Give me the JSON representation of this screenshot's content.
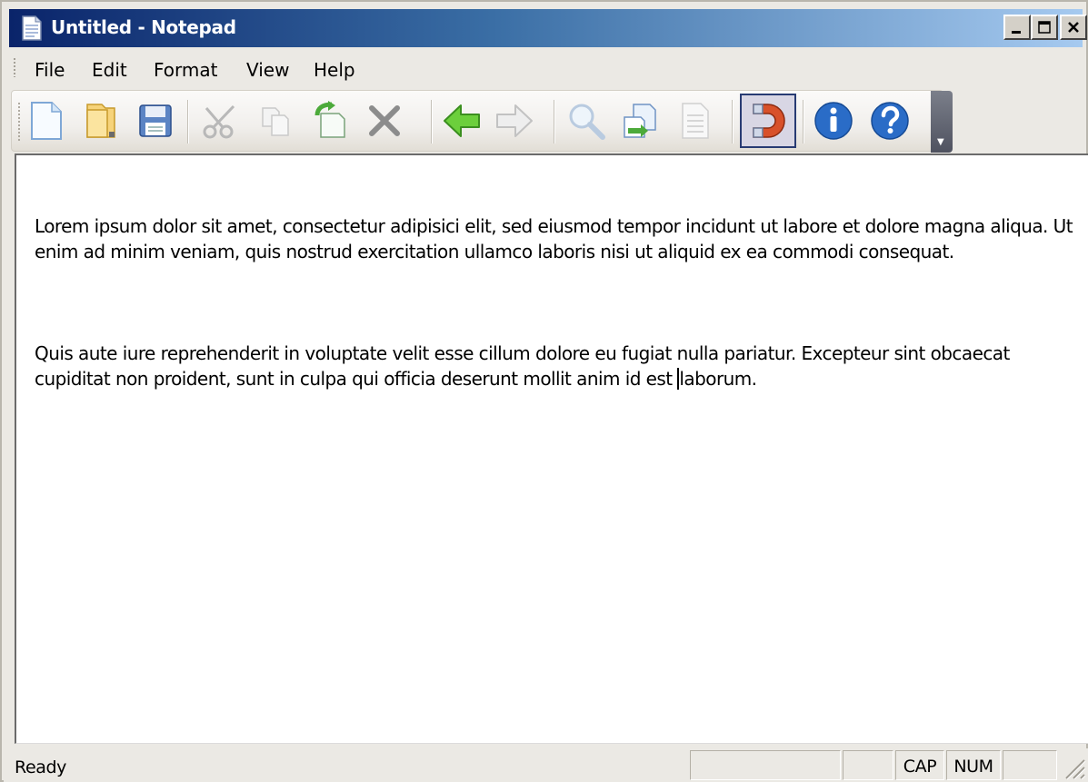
{
  "window": {
    "title": "Untitled - Notepad",
    "caption_buttons": [
      "minimize",
      "maximize",
      "close"
    ]
  },
  "menu": {
    "items": [
      {
        "label": "File"
      },
      {
        "label": "Edit"
      },
      {
        "label": "Format"
      },
      {
        "label": "View"
      },
      {
        "label": "Help"
      }
    ]
  },
  "toolbar": {
    "buttons": [
      {
        "icon": "new-document-icon"
      },
      {
        "icon": "open-folder-icon"
      },
      {
        "icon": "save-icon"
      },
      {
        "icon": "cut-icon",
        "disabled": true
      },
      {
        "icon": "copy-icon",
        "disabled": true
      },
      {
        "icon": "paste-icon"
      },
      {
        "icon": "delete-icon"
      },
      {
        "icon": "undo-arrow-icon"
      },
      {
        "icon": "redo-arrow-icon",
        "disabled": true
      },
      {
        "icon": "find-icon",
        "disabled": true
      },
      {
        "icon": "replace-icon"
      },
      {
        "icon": "page-icon",
        "disabled": true
      },
      {
        "icon": "magnet-icon",
        "pressed": true
      },
      {
        "icon": "info-icon"
      },
      {
        "icon": "help-icon"
      }
    ]
  },
  "editor": {
    "paragraphs": [
      "Lorem ipsum dolor sit amet, consectetur adipisici elit, sed eiusmod tempor incidunt ut labore et dolore magna aliqua. Ut enim ad minim veniam, quis nostrud exercitation ullamco laboris nisi ut aliquid ex ea commodi consequat.",
      "Quis aute iure reprehenderit in voluptate velit esse cillum dolore eu fugiat nulla pariatur. Excepteur sint obcaecat cupiditat non proident, sunt in culpa qui officia deserunt mollit anim id est ",
      "laborum."
    ]
  },
  "status": {
    "text": "Ready",
    "cap": "CAP",
    "num": "NUM"
  },
  "colors": {
    "titlebar_start": "#0a246a",
    "titlebar_end": "#a6caf0",
    "window_bg": "#ebe9e4"
  }
}
